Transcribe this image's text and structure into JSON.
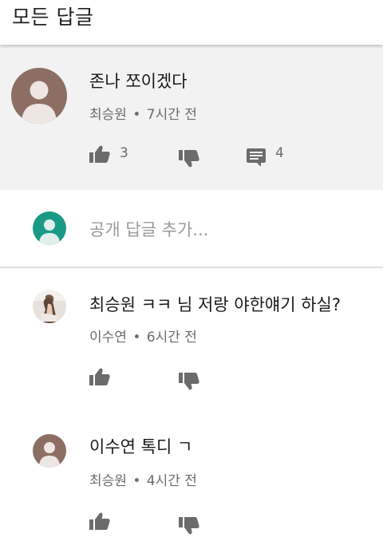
{
  "header": {
    "title": "모든 답글"
  },
  "parent_comment": {
    "text": "존나 쪼이겠다",
    "author": "최승원",
    "time": "7시간 전",
    "separator": "•",
    "like_count": "3",
    "reply_count": "4"
  },
  "add_reply": {
    "placeholder": "공개 답글 추가..."
  },
  "replies": [
    {
      "text": "최승원 ㅋㅋ 님 저랑 야한얘기 하실?",
      "author": "이수연",
      "separator": "•",
      "time": "6시간 전"
    },
    {
      "text": "이수연 톡디 ㄱ",
      "author": "최승원",
      "separator": "•",
      "time": "4시간 전"
    }
  ],
  "colors": {
    "parent_bg": "#f2f2f2",
    "avatar_brown": "#8d6e63",
    "avatar_teal": "#1a9a86",
    "icon_gray": "#6b6b6b"
  }
}
